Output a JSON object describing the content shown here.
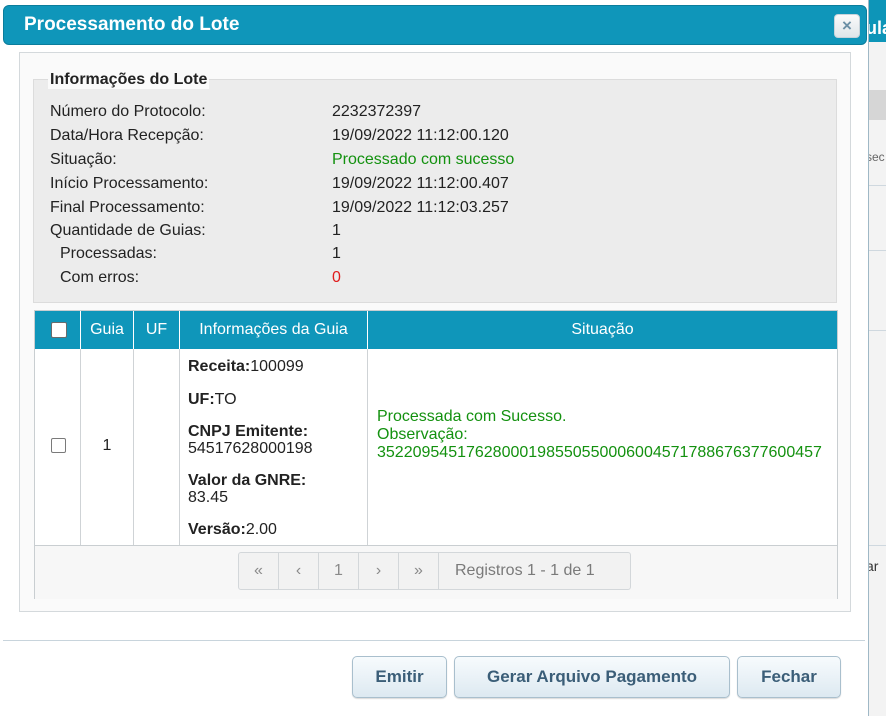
{
  "dialog": {
    "title": "Processamento do Lote",
    "close_icon": "×"
  },
  "info": {
    "legend": "Informações do Lote",
    "rows": [
      {
        "label": "Número do Protocolo:",
        "value": "2232372397"
      },
      {
        "label": "Data/Hora Recepção:",
        "value": "19/09/2022 11:12:00.120"
      },
      {
        "label": "Situação:",
        "value": "Processado com sucesso"
      },
      {
        "label": "Início Processamento:",
        "value": "19/09/2022 11:12:00.407"
      },
      {
        "label": "Final Processamento:",
        "value": "19/09/2022 11:12:03.257"
      },
      {
        "label": "Quantidade de Guias:",
        "value": "1"
      },
      {
        "label": "Processadas:",
        "value": "1"
      },
      {
        "label": "Com erros:",
        "value": "0"
      }
    ]
  },
  "grid": {
    "headers": {
      "guia": "Guia",
      "uf": "UF",
      "info": "Informações da Guia",
      "situacao": "Situação"
    },
    "row": {
      "guia": "1",
      "receita_label": "Receita:",
      "receita": "100099",
      "uf_label": "UF:",
      "uf": "TO",
      "cnpj_label": "CNPJ Emitente:",
      "cnpj": "54517628000198",
      "valor_label": "Valor da GNRE:",
      "valor": "83.45",
      "versao_label": "Versão:",
      "versao": "2.00",
      "situacao": "Processada com Sucesso.",
      "observacao_label": "Observação:",
      "observacao": "35220954517628000198550550006004571788676377600457"
    },
    "pager": {
      "first": "«",
      "prev": "‹",
      "page": "1",
      "next": "›",
      "last": "»",
      "info": "Registros 1 - 1 de 1"
    }
  },
  "buttons": {
    "emitir": "Emitir",
    "gerar": "Gerar Arquivo Pagamento",
    "fechar": "Fechar"
  },
  "background": {
    "title_fragment": "ula",
    "text1": "sec",
    "text2": "ar"
  },
  "colors": {
    "header": "#0f96ba",
    "success": "#13910f",
    "error": "#e01c1c"
  }
}
